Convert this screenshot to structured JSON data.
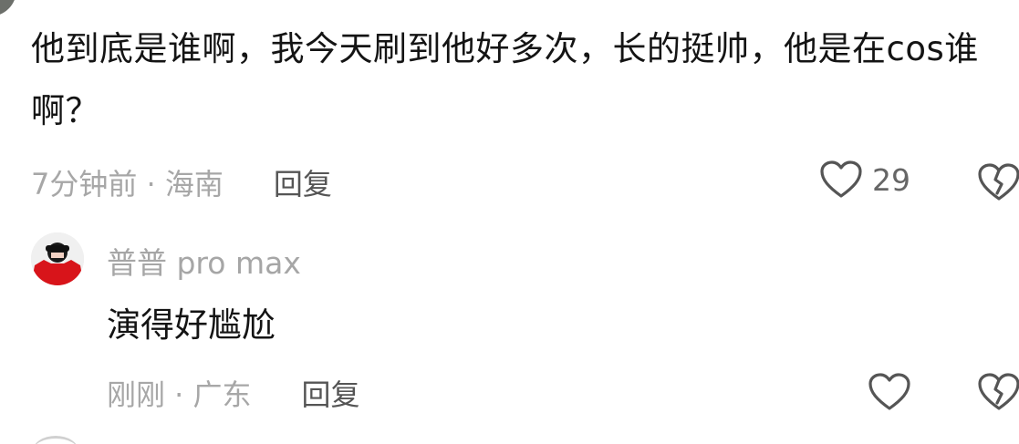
{
  "comment": {
    "text": "他到底是谁啊，我今天刷到他好多次，长的挺帅，他是在cos谁啊？",
    "time_location": "7分钟前 · 海南",
    "reply_label": "回复",
    "like_count": "29"
  },
  "reply": {
    "username": "普普 pro max",
    "text": "演得好尴尬",
    "time_location": "刚刚 · 广东",
    "reply_label": "回复"
  },
  "icons": {
    "like": "heart-outline-icon",
    "dislike": "broken-heart-icon"
  },
  "colors": {
    "text_primary": "#141414",
    "text_meta": "#a7a7a7",
    "reply_button": "#555555",
    "icon_stroke": "#555555",
    "avatar_red": "#d8141a"
  }
}
